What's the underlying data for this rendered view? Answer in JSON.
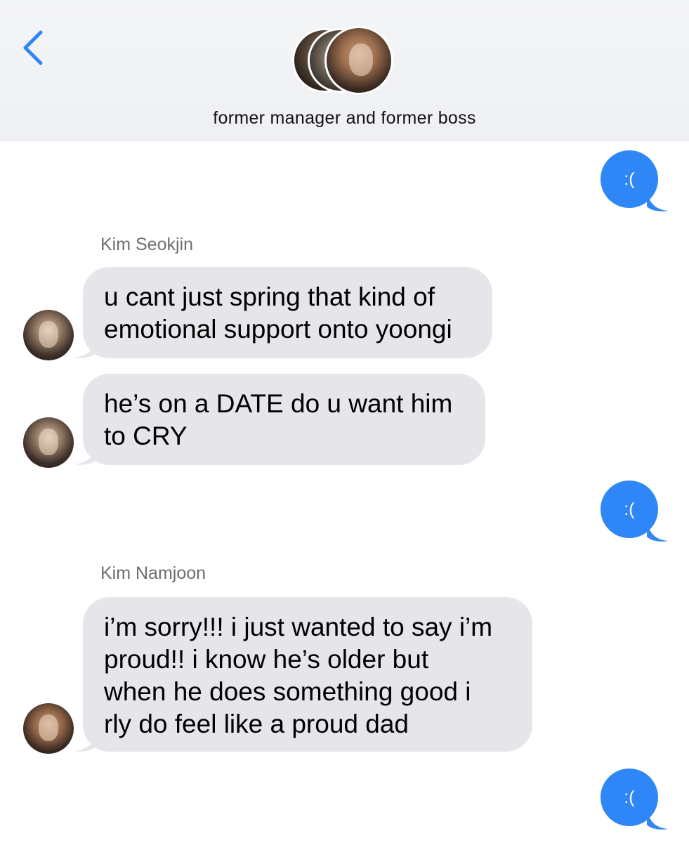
{
  "header": {
    "back_icon": "chevron-left-icon",
    "title": "former manager and former boss",
    "accent_color": "#2f86f6"
  },
  "messages": [
    {
      "type": "sent",
      "text": ":("
    },
    {
      "type": "sender",
      "name": "Kim Seokjin"
    },
    {
      "type": "received",
      "text": "u cant just spring that kind of\nemotional support onto yoongi"
    },
    {
      "type": "received",
      "text": "he’s on a DATE do u want him\nto CRY"
    },
    {
      "type": "sent",
      "text": ":("
    },
    {
      "type": "sender",
      "name": "Kim Namjoon"
    },
    {
      "type": "received",
      "text": "i’m sorry!!! i just wanted to say i’m\nproud!! i know he’s older but\nwhen he does something good i\nrly do feel like a proud dad"
    },
    {
      "type": "sent",
      "text": ":("
    }
  ],
  "colors": {
    "sent_bubble": "#2f86f6",
    "received_bubble": "#e5e5ea",
    "sender_name": "#6e6e73"
  }
}
